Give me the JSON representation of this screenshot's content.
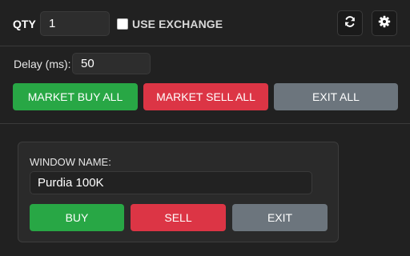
{
  "header": {
    "qty_label": "QTY",
    "qty_value": "1",
    "use_exchange_label": "USE EXCHANGE",
    "use_exchange_checked": false,
    "refresh_icon": "refresh-icon",
    "settings_icon": "gear-icon"
  },
  "delay": {
    "label": "Delay (ms):",
    "value": "50"
  },
  "global_actions": {
    "market_buy_all": "MARKET BUY ALL",
    "market_sell_all": "MARKET SELL ALL",
    "exit_all": "EXIT ALL"
  },
  "window_panel": {
    "name_label": "WINDOW NAME:",
    "name_value": "Purdia 100K",
    "buy": "BUY",
    "sell": "SELL",
    "exit": "EXIT"
  },
  "colors": {
    "buy": "#28a745",
    "sell": "#dc3545",
    "exit": "#6c757d",
    "background": "#212121"
  }
}
